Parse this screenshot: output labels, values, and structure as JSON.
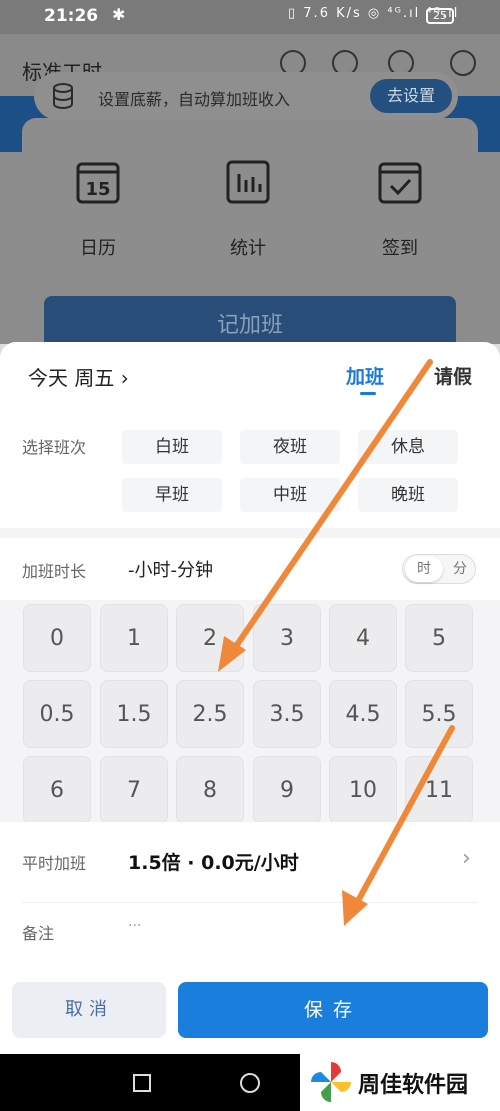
{
  "status_bar": {
    "time": "21:26",
    "bluetooth_icon": "bluetooth-icon",
    "right_icons": "▯ 7.6 K/s ◎ ⁴ᴳ.ıl ⁴ᴳ.ıl",
    "battery": "25"
  },
  "app": {
    "title": "标准工时",
    "banner_text": "设置底薪，自动算加班收入",
    "banner_button": "去设置",
    "features": [
      {
        "label": "日历",
        "icon": "calendar-icon",
        "date": "15"
      },
      {
        "label": "统计",
        "icon": "stats-icon"
      },
      {
        "label": "签到",
        "icon": "checkin-icon"
      }
    ],
    "record_button": "记加班"
  },
  "sheet": {
    "date": "今天  周五 ›",
    "tabs": [
      "加班",
      "请假"
    ],
    "active_tab": "加班",
    "shift_label": "选择班次",
    "shifts": [
      "白班",
      "夜班",
      "休息",
      "早班",
      "中班",
      "晚班"
    ],
    "duration_label": "加班时长",
    "duration_value": "-小时-分钟",
    "unit_toggle": {
      "hour": "时",
      "minute": "分"
    },
    "keypad": [
      "0",
      "1",
      "2",
      "3",
      "4",
      "5",
      "0.5",
      "1.5",
      "2.5",
      "3.5",
      "4.5",
      "5.5",
      "6",
      "7",
      "8",
      "9",
      "10",
      "11"
    ],
    "rate_label": "平时加班",
    "rate_value": "1.5倍 · 0.0元/小时",
    "note_label": "备注",
    "note_placeholder": "···",
    "cancel_button": "取消",
    "save_button": "保存"
  },
  "watermark": {
    "text": "周佳软件园"
  },
  "colors": {
    "accent": "#1a7fdc",
    "arrow": "#f0883a",
    "dark_blue": "#23507f"
  }
}
